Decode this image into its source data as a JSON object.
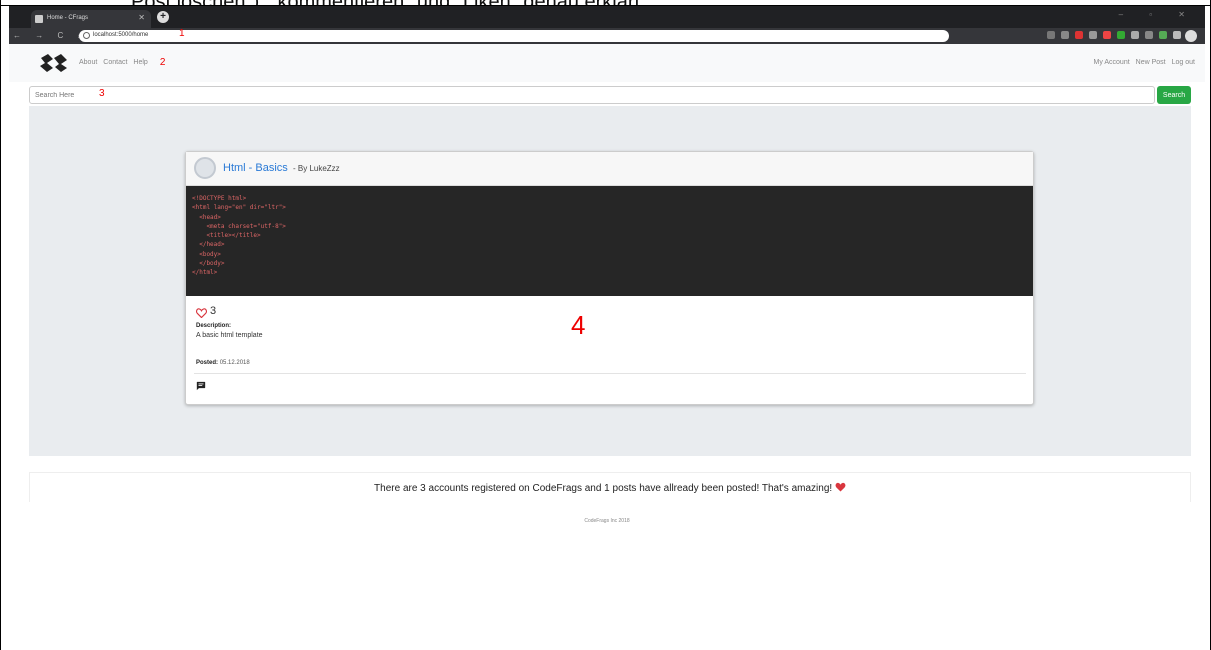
{
  "doc_heading": "Post löschen\"), \"kommentieren\" und \"Liken\" genau erklärt",
  "browser": {
    "tab_title": "Home - CFrags",
    "url": "localhost:5000/home"
  },
  "annotations": [
    "1",
    "2",
    "3",
    "4"
  ],
  "nav": {
    "links": [
      "About",
      "Contact",
      "Help"
    ],
    "right_links": [
      "My Account",
      "New Post",
      "Log out"
    ]
  },
  "search": {
    "placeholder": "Search Here",
    "button_label": "Search"
  },
  "post": {
    "title": "Html - Basics",
    "byline": "- By LukeZzz",
    "code_lines": [
      "<!DOCTYPE html>",
      "<html lang=\"en\" dir=\"ltr\">",
      "  <head>",
      "    <meta charset=\"utf-8\">",
      "    <title></title>",
      "  </head>",
      "  <body>",
      "",
      "  </body>",
      "</html>"
    ],
    "likes": "3",
    "description_label": "Description:",
    "description": "A basic html template",
    "posted_label": "Posted:",
    "posted_date": "05.12.2018"
  },
  "stats_text": "There are 3 accounts registered on CodeFrags and 1 posts have allready been posted! That's amazing!",
  "footer": "CodeFrags Inc 2018",
  "colors": {
    "accent_blue": "#2a7ad6",
    "search_green": "#28a745",
    "heart_red": "#d9363e",
    "annotation_red": "#e00000"
  }
}
